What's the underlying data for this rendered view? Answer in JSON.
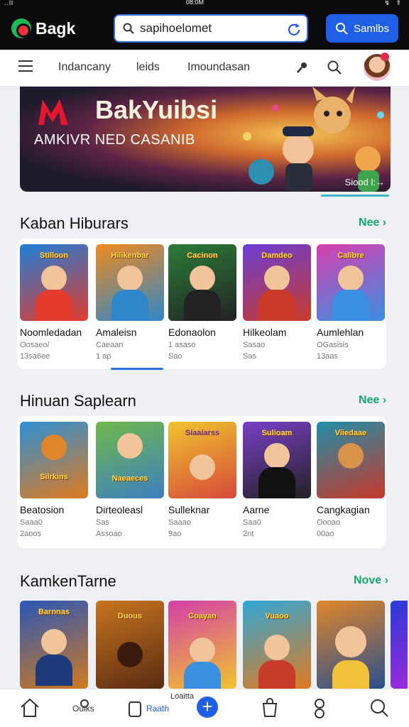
{
  "status_bar": {
    "time": "08:0M",
    "signal": "..ll",
    "icons": "↯ ⇑"
  },
  "app": {
    "name": "Bagk"
  },
  "search": {
    "value": "sapihoelomet",
    "button_label": "Samlbs"
  },
  "nav": {
    "links": [
      "Indancany",
      "leids",
      "Imoundasan"
    ]
  },
  "banner": {
    "title": "BakYuibsi",
    "subtitle": "AMKIVR NED CASANIB",
    "cta": "Siood l:→"
  },
  "sections": [
    {
      "title": "Kaban Hiburars",
      "see_more": "Nee",
      "games": [
        {
          "name": "Noomledadan",
          "meta1": "Oosaeo/",
          "meta2": "13sa6ee",
          "caption": "Stilloon",
          "palette": [
            "#1e7fd8",
            "#e23b2e"
          ]
        },
        {
          "name": "Amaleisn",
          "meta1": "Caeaan",
          "meta2": "1 ap",
          "caption": "Hilikenbar",
          "palette": [
            "#ef8a1f",
            "#2f86c9"
          ]
        },
        {
          "name": "Edonaolon",
          "meta1": "1 asaso",
          "meta2": "Sao",
          "caption": "Cacinon",
          "palette": [
            "#2c7d3a",
            "#222"
          ]
        },
        {
          "name": "Hilkeolam",
          "meta1": "Sasao",
          "meta2": "Sas",
          "caption": "Damdeo",
          "palette": [
            "#6b3fd6",
            "#c93a2a"
          ]
        },
        {
          "name": "Aumlehlan",
          "meta1": "OGasisis",
          "meta2": "13aas",
          "caption": "Calibre",
          "palette": [
            "#d83fb0",
            "#3a8fe0"
          ]
        }
      ]
    },
    {
      "title": "Hinuan Saplearn",
      "see_more": "Nee",
      "games": [
        {
          "name": "Beatosion",
          "meta1": "Saaa0",
          "meta2": "2aoos",
          "caption": "Silrkins",
          "palette": [
            "#2d8fd6",
            "#e07a1f"
          ]
        },
        {
          "name": "Dirteoleasl",
          "meta1": "Sas",
          "meta2": "Assoao",
          "caption": "Naeaeces",
          "palette": [
            "#6fb84a",
            "#3d7fc2"
          ]
        },
        {
          "name": "Sulleknar",
          "meta1": "Saaao",
          "meta2": "9ao",
          "caption": "Siaaiarss",
          "palette": [
            "#f0c42e",
            "#d6493a"
          ]
        },
        {
          "name": "Aarne",
          "meta1": "Saa0",
          "meta2": "2nt",
          "caption": "Sulioam",
          "palette": [
            "#7a3fc8",
            "#222"
          ]
        },
        {
          "name": "Cangkagian",
          "meta1": "Oooao",
          "meta2": "00ao",
          "caption": "Viiedaae",
          "palette": [
            "#1f8fa8",
            "#c8382a"
          ]
        }
      ]
    },
    {
      "title": "KamkenTarne",
      "see_more": "Nove",
      "games": [
        {
          "name": "",
          "meta1": "",
          "meta2": "",
          "caption": "Barnnas",
          "palette": [
            "#2a56b8",
            "#d07a1f"
          ]
        },
        {
          "name": "",
          "meta1": "",
          "meta2": "",
          "caption": "Duous",
          "palette": [
            "#c8741f",
            "#5a2b12"
          ]
        },
        {
          "name": "",
          "meta1": "",
          "meta2": "",
          "caption": "Coayan",
          "palette": [
            "#d43fa8",
            "#f0c42e"
          ]
        },
        {
          "name": "",
          "meta1": "",
          "meta2": "",
          "caption": "Vuaoo",
          "palette": [
            "#2fa8d8",
            "#e07a1f"
          ]
        },
        {
          "name": "",
          "meta1": "",
          "meta2": "",
          "caption": "",
          "palette": [
            "#e0862a",
            "#2a4f8f"
          ]
        }
      ]
    }
  ],
  "bottom_nav": {
    "items": [
      "Home",
      "Quras",
      "Raath",
      "",
      "Bag",
      "Profile",
      "Search"
    ],
    "labels": {
      "quras": "Ouiks",
      "raath": "Raath",
      "hidden": "Loaitta"
    }
  }
}
